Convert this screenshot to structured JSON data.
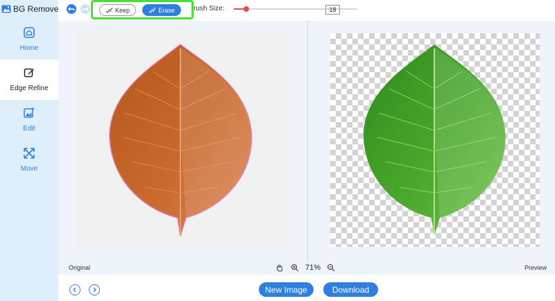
{
  "app": {
    "title": "BG Remover"
  },
  "sidebar": {
    "items": [
      {
        "label": "Home",
        "icon": "home-icon"
      },
      {
        "label": "Edge Refine",
        "icon": "edit-pen-icon",
        "active": true
      },
      {
        "label": "Edit",
        "icon": "image-edit-icon"
      },
      {
        "label": "Move",
        "icon": "move-arrows-icon"
      }
    ]
  },
  "toolbar": {
    "keep_label": "Keep",
    "erase_label": "Erase",
    "brush_label": "rush Size:",
    "brush_value": "18",
    "brush_fraction": 0.1
  },
  "canvas": {
    "original_label": "Original",
    "preview_label": "Preview"
  },
  "zoom": {
    "value": "71%"
  },
  "actions": {
    "new_image_label": "New Image",
    "download_label": "Download"
  },
  "colors": {
    "accent": "#2f7fe0",
    "highlight_border": "#46e231",
    "sidebar_bg": "#dfeefb",
    "slider_thumb": "#e84b4b",
    "leaf_orange": "#c8662a",
    "leaf_green": "#4aa82c"
  }
}
